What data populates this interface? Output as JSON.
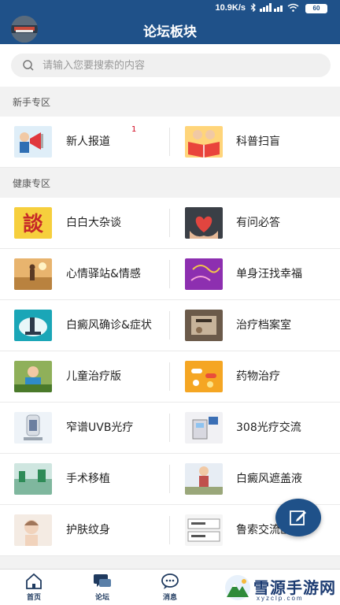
{
  "status_bar": {
    "speed": "10.9K/s",
    "battery": "60"
  },
  "header": {
    "title": "论坛板块",
    "avatar_icon": "user-avatar"
  },
  "search": {
    "placeholder": "请输入您要搜索的内容"
  },
  "sections": [
    {
      "title": "新手专区",
      "rows": [
        [
          {
            "label": "新人报道",
            "badge": "1",
            "icon": "megaphone-announcer"
          },
          {
            "label": "科普扫盲",
            "icon": "open-book-kids"
          }
        ]
      ]
    },
    {
      "title": "健康专区",
      "rows": [
        [
          {
            "label": "白白大杂谈",
            "icon": "talk-character"
          },
          {
            "label": "有问必答",
            "icon": "heart-hands"
          }
        ],
        [
          {
            "label": "心情驿站&情感",
            "icon": "field-person"
          },
          {
            "label": "单身汪找幸福",
            "icon": "purple-love"
          }
        ],
        [
          {
            "label": "白癜风确诊&症状",
            "icon": "lab-microscope"
          },
          {
            "label": "治疗档案室",
            "icon": "archive-files"
          }
        ],
        [
          {
            "label": "儿童治疗版",
            "icon": "child-photo"
          },
          {
            "label": "药物治疗",
            "icon": "pills"
          }
        ],
        [
          {
            "label": "窄谱UVB光疗",
            "icon": "uvb-device"
          },
          {
            "label": "308光疗交流",
            "icon": "laser-machine"
          }
        ],
        [
          {
            "label": "手术移植",
            "icon": "surgery-lab"
          },
          {
            "label": "白癜风遮盖液",
            "icon": "cover-liquid"
          }
        ],
        [
          {
            "label": "护肤纹身",
            "icon": "skincare-woman"
          },
          {
            "label": "鲁索交流区",
            "icon": "opzelura-box"
          }
        ]
      ]
    }
  ],
  "bottom_nav": [
    {
      "label": "首页",
      "icon": "home-icon"
    },
    {
      "label": "论坛",
      "icon": "forum-icon"
    },
    {
      "label": "消息",
      "icon": "message-icon"
    }
  ],
  "watermark": {
    "text": "雪源手游网",
    "sub": "xyzclp.com"
  },
  "colors": {
    "primary": "#1f5189",
    "badge": "#d0021b"
  }
}
